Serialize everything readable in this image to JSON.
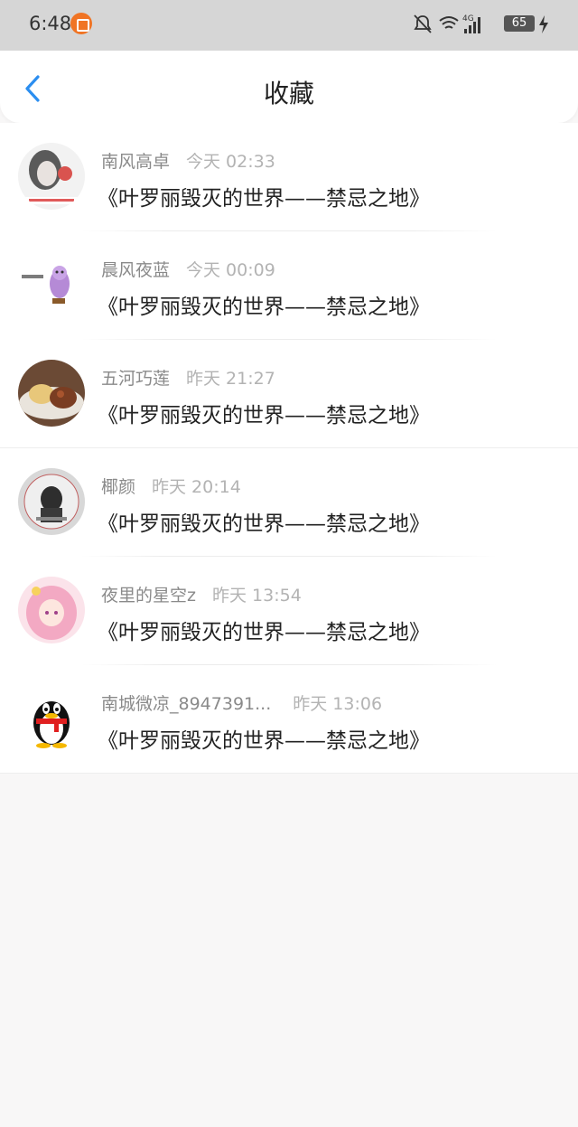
{
  "status_bar": {
    "time": "6:48",
    "battery": "65",
    "icons": [
      "app-notification-icon",
      "bell-off-icon",
      "wifi-icon",
      "signal-4g-icon",
      "battery-icon",
      "charging-icon"
    ]
  },
  "nav": {
    "title": "收藏",
    "back_icon": "chevron-left-icon"
  },
  "items": [
    {
      "user": "南风高卓",
      "time": "今天 02:33",
      "book": "《叶罗丽毁灭的世界——禁忌之地》"
    },
    {
      "user": "晨风夜蓝",
      "time": "今天 00:09",
      "book": "《叶罗丽毁灭的世界——禁忌之地》"
    },
    {
      "user": "五河巧莲",
      "time": "昨天 21:27",
      "book": "《叶罗丽毁灭的世界——禁忌之地》"
    },
    {
      "user": "椰颜",
      "time": "昨天 20:14",
      "book": "《叶罗丽毁灭的世界——禁忌之地》"
    },
    {
      "user": "夜里的星空z",
      "time": "昨天 13:54",
      "book": "《叶罗丽毁灭的世界——禁忌之地》"
    },
    {
      "user": "南城微凉_8947391...",
      "time": "昨天 13:06",
      "book": "《叶罗丽毁灭的世界——禁忌之地》"
    }
  ],
  "colors": {
    "accent": "#2b8ef0",
    "status_bar_bg": "#d6d6d6",
    "page_bg": "#f8f7f7"
  }
}
